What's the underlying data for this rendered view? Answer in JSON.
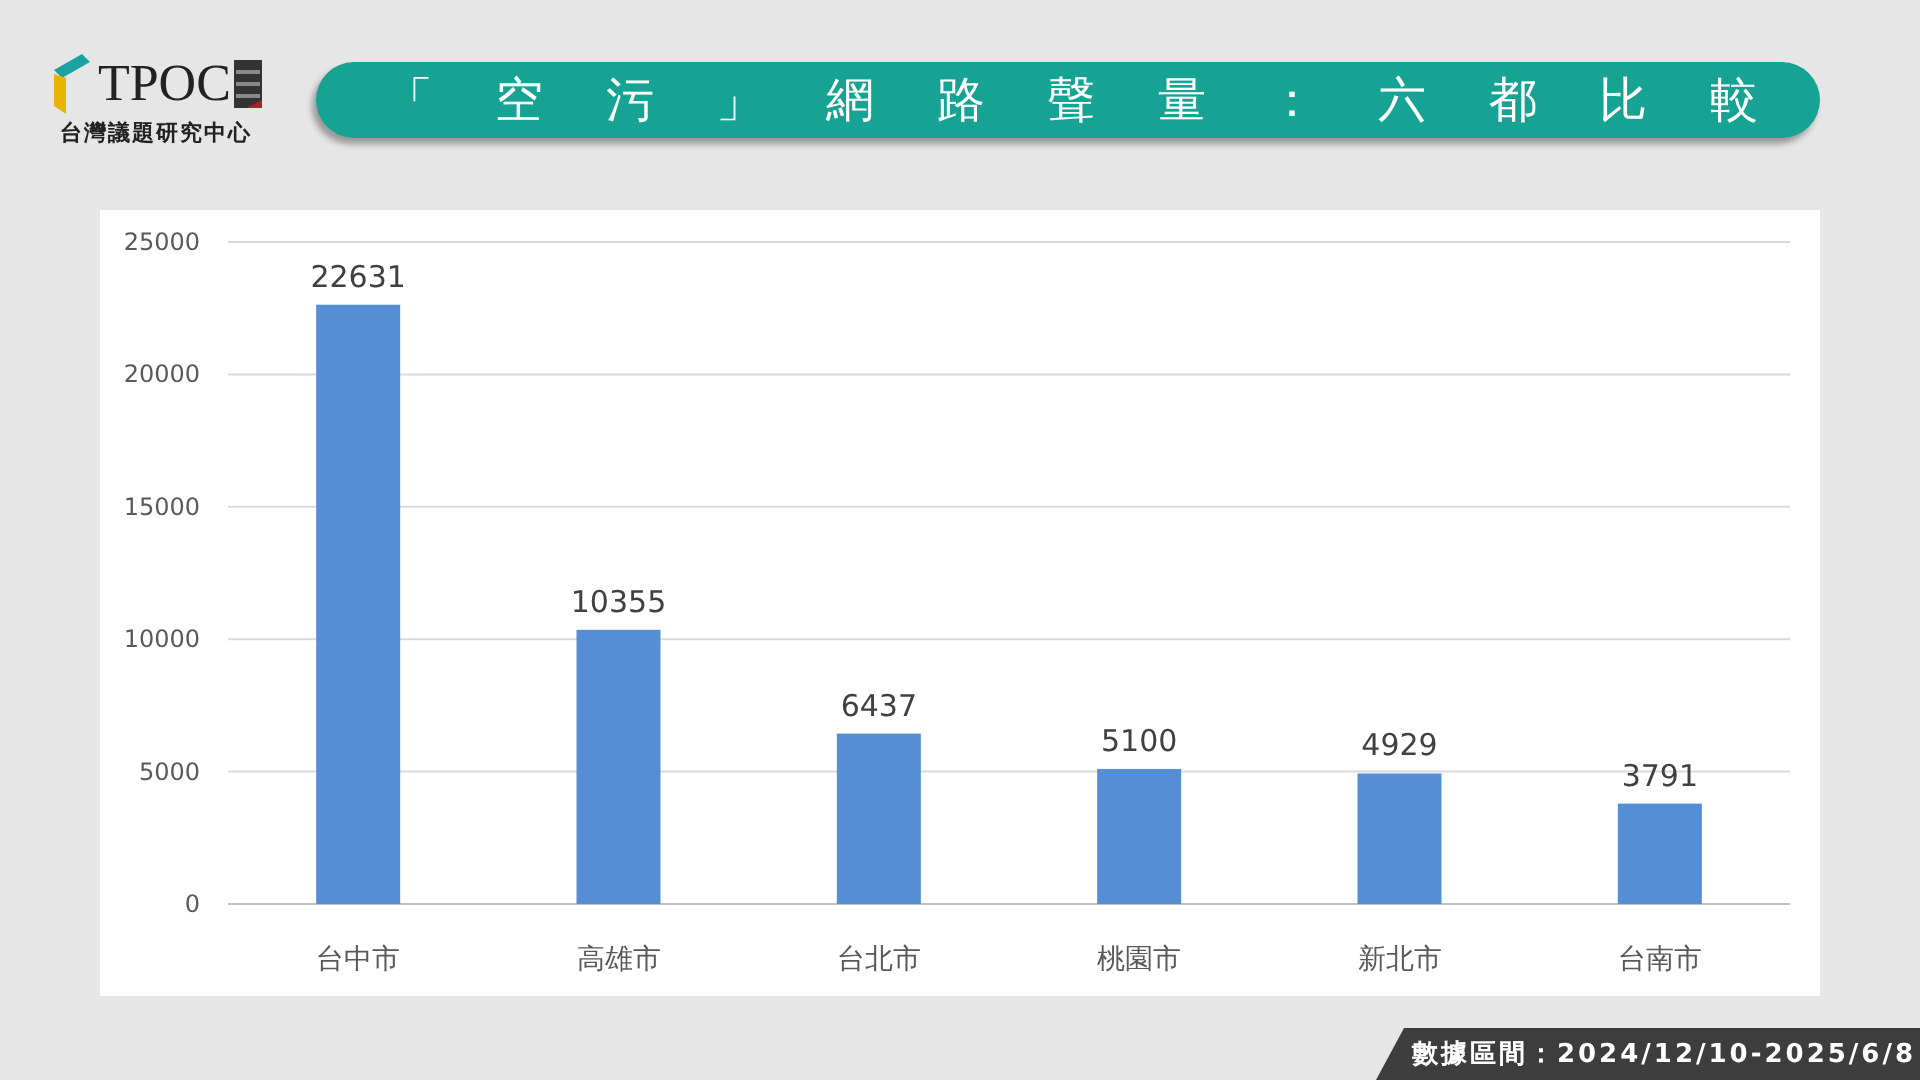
{
  "logo": {
    "mark": "TPOC",
    "subtitle": "台灣議題研究中心"
  },
  "title": "「空污」網路聲量：六都比較",
  "chart_data": {
    "type": "bar",
    "categories": [
      "台中市",
      "高雄市",
      "台北市",
      "桃園市",
      "新北市",
      "台南市"
    ],
    "series": [
      {
        "color": "#558ed5",
        "values": [
          22631,
          10355,
          6437,
          5100,
          4929,
          3791
        ]
      }
    ],
    "ylim": [
      0,
      25000
    ],
    "yticks": [
      0,
      5000,
      10000,
      15000,
      20000,
      25000
    ],
    "data_labels": true,
    "grid": true
  },
  "footer": "數據區間：2024/12/10-2025/6/8"
}
